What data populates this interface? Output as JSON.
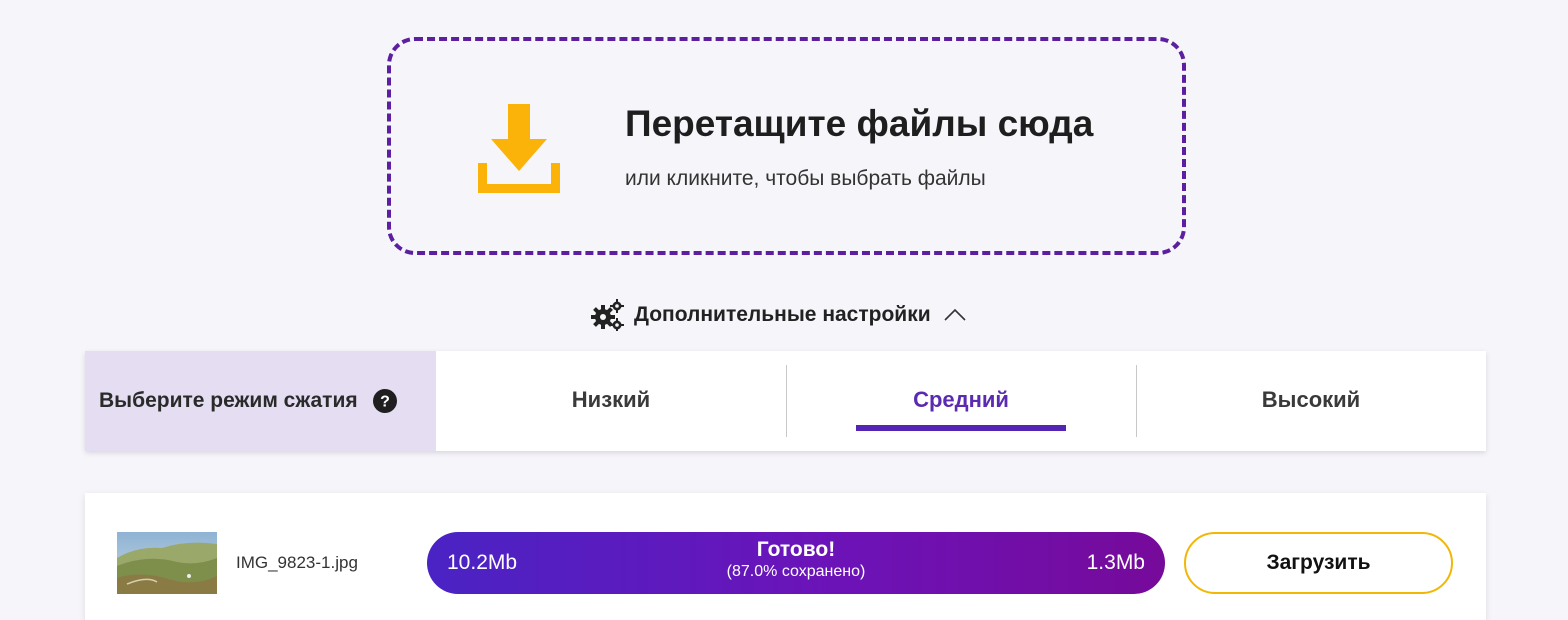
{
  "dropzone": {
    "title": "Перетащите файлы сюда",
    "subtitle": "или кликните, чтобы выбрать файлы",
    "icon": "download-icon",
    "border_color": "#5c1fa0",
    "icon_color": "#fbb30a"
  },
  "settings": {
    "label": "Дополнительные настройки",
    "icon": "gears-icon",
    "expanded": true
  },
  "compression": {
    "label": "Выберите режим сжатия",
    "help_icon": "question-icon",
    "tabs": [
      {
        "label": "Низкий",
        "active": false
      },
      {
        "label": "Средний",
        "active": true
      },
      {
        "label": "Высокий",
        "active": false
      }
    ],
    "accent_color": "#5425b5"
  },
  "files": [
    {
      "name": "IMG_9823-1.jpg",
      "original_size": "10.2Mb",
      "compressed_size": "1.3Mb",
      "status": "Готово!",
      "saved": "(87.0% сохранено)",
      "download_label": "Загрузить"
    }
  ]
}
